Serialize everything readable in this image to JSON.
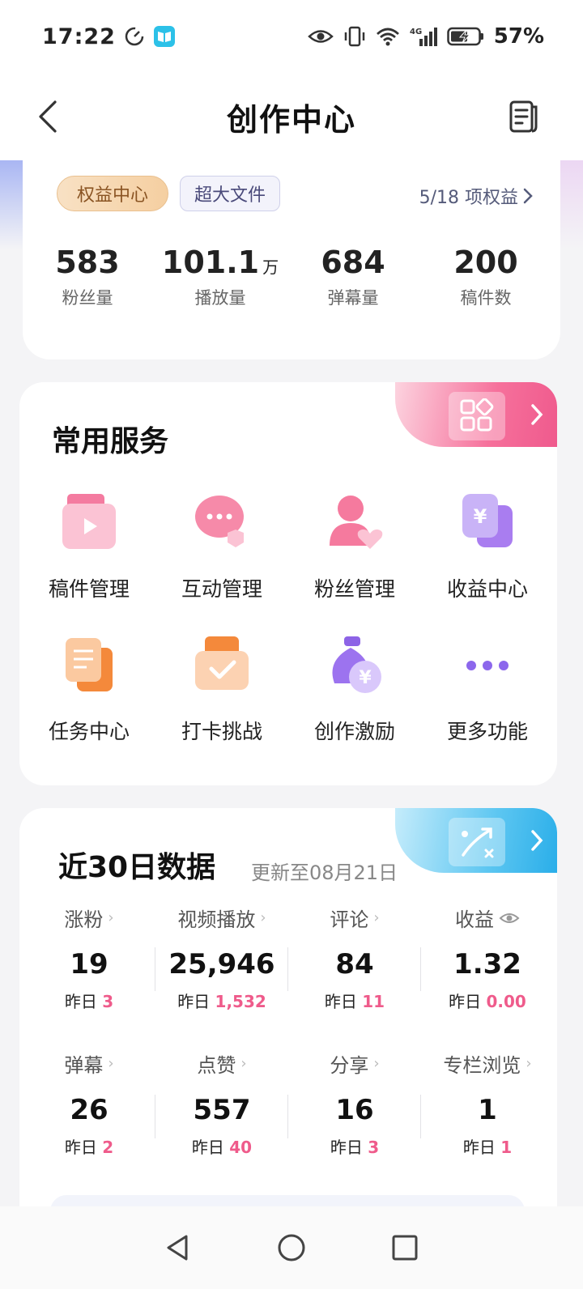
{
  "status": {
    "time": "17:22",
    "battery": "57%",
    "network": "4G"
  },
  "nav": {
    "title": "创作中心"
  },
  "top": {
    "badge_primary": "权益中心",
    "badge_secondary": "超大文件",
    "rights_link": "5/18 项权益",
    "stats": [
      {
        "value": "583",
        "unit": "",
        "label": "粉丝量"
      },
      {
        "value": "101.1",
        "unit": "万",
        "label": "播放量"
      },
      {
        "value": "684",
        "unit": "",
        "label": "弹幕量"
      },
      {
        "value": "200",
        "unit": "",
        "label": "稿件数"
      }
    ]
  },
  "services": {
    "title": "常用服务",
    "items": [
      {
        "label": "稿件管理",
        "icon": "video-doc-icon"
      },
      {
        "label": "互动管理",
        "icon": "chat-bubble-icon"
      },
      {
        "label": "粉丝管理",
        "icon": "fan-heart-icon"
      },
      {
        "label": "收益中心",
        "icon": "yuan-card-icon"
      },
      {
        "label": "任务中心",
        "icon": "task-clipboard-icon"
      },
      {
        "label": "打卡挑战",
        "icon": "checkin-icon"
      },
      {
        "label": "创作激励",
        "icon": "money-bag-icon"
      },
      {
        "label": "更多功能",
        "icon": "more-dots-icon"
      }
    ]
  },
  "data30": {
    "title": "近30日数据",
    "updated": "更新至08月21日",
    "yesterday_label": "昨日",
    "metrics": [
      {
        "label": "涨粉",
        "value": "19",
        "yesterday": "3"
      },
      {
        "label": "视频播放",
        "value": "25,946",
        "yesterday": "1,532"
      },
      {
        "label": "评论",
        "value": "84",
        "yesterday": "11"
      },
      {
        "label": "收益",
        "value": "1.32",
        "yesterday": "0.00"
      },
      {
        "label": "弹幕",
        "value": "26",
        "yesterday": "2"
      },
      {
        "label": "点赞",
        "value": "557",
        "yesterday": "40"
      },
      {
        "label": "分享",
        "value": "16",
        "yesterday": "3"
      },
      {
        "label": "专栏浏览",
        "value": "1",
        "yesterday": "1"
      }
    ]
  },
  "colors": {
    "accent_pink": "#ef5b8b",
    "accent_blue": "#2aaee9",
    "gold": "#8a5423"
  }
}
